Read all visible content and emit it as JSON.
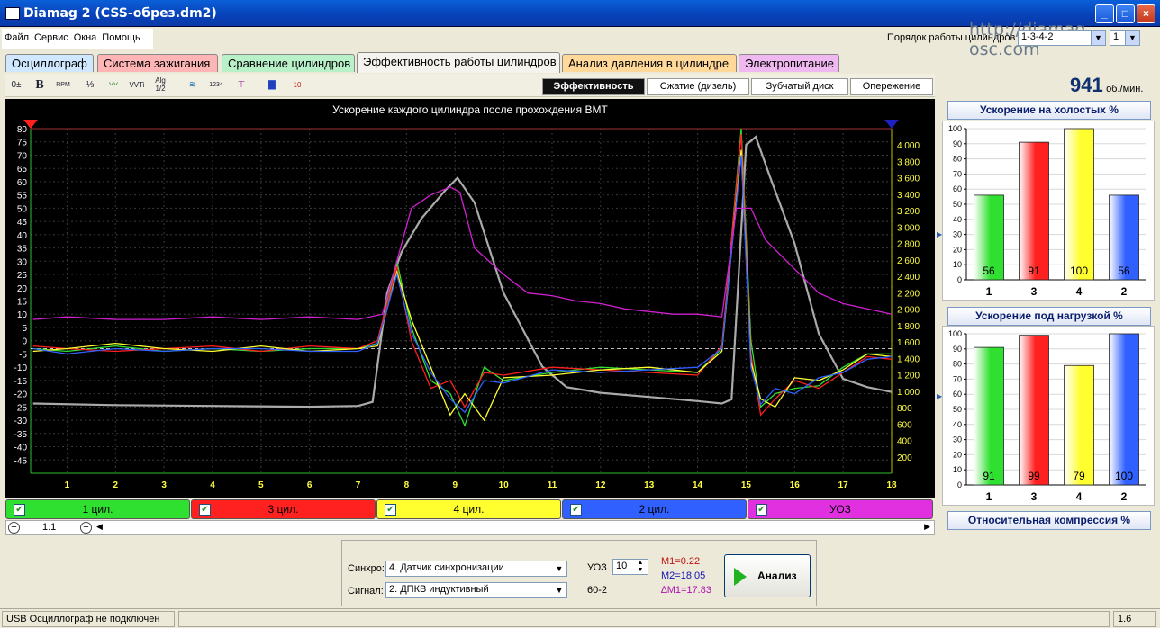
{
  "window": {
    "title": "Diamag 2 (CSS-обрез.dm2)",
    "minimize": "_",
    "maximize": "□",
    "close": "×"
  },
  "menu": [
    "Файл",
    "Сервис",
    "Окна",
    "Помощь"
  ],
  "watermark": "http://diamag-osc.com",
  "firing_order": {
    "label": "Порядок работы цилиндров",
    "value": "1-3-4-2",
    "second": "1"
  },
  "tabs": [
    {
      "label": "Осциллограф",
      "color": "#d0e8ff"
    },
    {
      "label": "Система зажигания",
      "color": "#ffb5b5"
    },
    {
      "label": "Сравнение цилиндров",
      "color": "#b8f0c8"
    },
    {
      "label": "Эффективность работы цилиндров",
      "color": "#f4f3ee"
    },
    {
      "label": "Анализ давления в цилиндре",
      "color": "#ffd89a"
    },
    {
      "label": "Электропитание",
      "color": "#f0b8f0"
    }
  ],
  "subtabs": [
    "Эффективность",
    "Сжатие (дизель)",
    "Зубчатый диск",
    "Опережение"
  ],
  "rpm": {
    "value": "941",
    "unit": "об./мин."
  },
  "toolbar_icons": [
    "scale-icon",
    "bold-icon",
    "rpm-icon",
    "ratio-icon",
    "zigzag-icon",
    "vvti-icon",
    "alg-icon",
    "sync-icon",
    "export-icon",
    "filter-icon",
    "bars-icon",
    "counter-icon"
  ],
  "toolbar_texts": {
    "bold": "B",
    "rpm": "RPM",
    "vvti": "VVTi",
    "alg": "Alg 1/2",
    "t34": "1234",
    "t10": "10"
  },
  "chart_data": {
    "type": "line",
    "title": "Ускорение каждого цилиндра после прохождения ВМТ",
    "x_ticks": [
      "1",
      "2",
      "3",
      "4",
      "5",
      "6",
      "7",
      "8",
      "9",
      "10",
      "11",
      "12",
      "13",
      "14",
      "15",
      "16",
      "17",
      "18"
    ],
    "y_left_ticks": [
      "80",
      "75",
      "70",
      "65",
      "60",
      "55",
      "50",
      "45",
      "40",
      "35",
      "30",
      "25",
      "20",
      "15",
      "10",
      "5",
      "0",
      "-5",
      "-10",
      "-15",
      "-20",
      "-25",
      "-30",
      "-35",
      "-40",
      "-45"
    ],
    "y_right_ticks": [
      "4 000",
      "3 800",
      "3 600",
      "3 400",
      "3 200",
      "3 000",
      "2 800",
      "2 600",
      "2 400",
      "2 200",
      "2 000",
      "1 800",
      "1 600",
      "1 400",
      "1 200",
      "1 000",
      "800",
      "600",
      "400",
      "200"
    ],
    "ylim_left": [
      -50,
      80
    ],
    "ylim_right": [
      0,
      4200
    ],
    "xlim": [
      0.25,
      18
    ],
    "series": [
      {
        "name": "1 цил.",
        "color": "#30e030",
        "x": [
          0.3,
          1,
          2,
          3,
          4,
          5,
          6,
          7,
          7.4,
          7.8,
          8.1,
          8.5,
          8.9,
          9.2,
          9.6,
          10,
          11,
          12,
          13,
          14,
          14.5,
          14.9,
          15.1,
          15.3,
          15.6,
          16,
          16.5,
          17,
          17.5,
          18
        ],
        "y": [
          -3,
          -4,
          -2,
          -4,
          -3,
          -4,
          -3,
          -3,
          -1,
          30,
          5,
          -15,
          -20,
          -32,
          -10,
          -15,
          -12,
          -10,
          -11,
          -12,
          -3,
          80,
          0,
          -25,
          -20,
          -18,
          -17,
          -10,
          -5,
          -5
        ]
      },
      {
        "name": "3 цил.",
        "color": "#ff2020",
        "x": [
          0.3,
          1,
          2,
          3,
          4,
          5,
          6,
          7,
          7.4,
          7.8,
          8.1,
          8.5,
          8.9,
          9.2,
          9.6,
          10,
          11,
          12,
          13,
          14,
          14.5,
          14.9,
          15.1,
          15.3,
          15.6,
          16,
          16.5,
          17,
          17.5,
          18
        ],
        "y": [
          -2,
          -3,
          -4,
          -3,
          -2,
          -4,
          -2,
          -3,
          0,
          28,
          0,
          -18,
          -15,
          -25,
          -12,
          -13,
          -10,
          -11,
          -12,
          -13,
          -2,
          78,
          -5,
          -28,
          -22,
          -15,
          -18,
          -12,
          -6,
          -7
        ]
      },
      {
        "name": "4 цил.",
        "color": "#ffff30",
        "x": [
          0.3,
          1,
          2,
          3,
          4,
          5,
          6,
          7,
          7.4,
          7.8,
          8.1,
          8.5,
          8.9,
          9.2,
          9.6,
          10,
          11,
          12,
          13,
          14,
          14.5,
          14.9,
          15.1,
          15.3,
          15.6,
          16,
          16.5,
          17,
          17.5,
          18
        ],
        "y": [
          -4,
          -3,
          -1,
          -3,
          -4,
          -2,
          -4,
          -3,
          -2,
          26,
          8,
          -10,
          -28,
          -20,
          -30,
          -14,
          -13,
          -11,
          -10,
          -12,
          -4,
          72,
          -8,
          -22,
          -25,
          -14,
          -15,
          -11,
          -5,
          -6
        ]
      },
      {
        "name": "2 цил.",
        "color": "#3060ff",
        "x": [
          0.3,
          1,
          2,
          3,
          4,
          5,
          6,
          7,
          7.4,
          7.8,
          8.1,
          8.5,
          8.9,
          9.2,
          9.6,
          10,
          11,
          12,
          13,
          14,
          14.5,
          14.9,
          15.1,
          15.3,
          15.6,
          16,
          16.5,
          17,
          17.5,
          18
        ],
        "y": [
          -3,
          -5,
          -3,
          -4,
          -3,
          -3,
          -4,
          -4,
          -1,
          25,
          3,
          -12,
          -22,
          -27,
          -15,
          -16,
          -11,
          -12,
          -11,
          -10,
          -3,
          70,
          -10,
          -24,
          -18,
          -20,
          -14,
          -12,
          -7,
          -6
        ]
      },
      {
        "name": "УОЗ",
        "color": "#d020d0",
        "x": [
          0.3,
          1,
          2,
          3,
          4,
          5,
          6,
          7,
          7.5,
          7.8,
          8.1,
          8.5,
          8.9,
          9.1,
          9.4,
          10,
          10.5,
          11,
          11.5,
          12,
          12.5,
          13,
          13.5,
          14,
          14.5,
          14.8,
          15.1,
          15.4,
          16,
          16.5,
          17,
          17.5,
          18
        ],
        "y": [
          8,
          9,
          8,
          8,
          9,
          8,
          9,
          8,
          10,
          30,
          50,
          55,
          58,
          56,
          35,
          25,
          18,
          17,
          15,
          14,
          12,
          11,
          10,
          10,
          9,
          50,
          50,
          38,
          27,
          18,
          14,
          12,
          10
        ]
      },
      {
        "name": "Обороты",
        "color": "#aaaaaa",
        "axis": "right",
        "x": [
          0.3,
          2,
          4,
          6,
          7,
          7.3,
          7.6,
          7.9,
          8.3,
          8.8,
          9.05,
          9.4,
          10,
          10.8,
          11.3,
          12,
          13,
          14,
          14.5,
          14.7,
          15.0,
          15.2,
          15.5,
          16,
          16.5,
          17,
          17.5,
          18
        ],
        "y": [
          850,
          830,
          820,
          810,
          820,
          870,
          2200,
          2700,
          3100,
          3450,
          3600,
          3300,
          2200,
          1300,
          1050,
          980,
          930,
          880,
          850,
          900,
          4000,
          4100,
          3600,
          2800,
          1700,
          1150,
          1050,
          990
        ]
      }
    ],
    "markers": {
      "left_triangle": "#ff2020",
      "right_triangle": "#2020c0"
    },
    "dashed_reference_y": -3
  },
  "legend": [
    {
      "label": "1 цил.",
      "bg": "#30e030",
      "check": "✔"
    },
    {
      "label": "3 цил.",
      "bg": "#ff2020",
      "check": "✔"
    },
    {
      "label": "4 цил.",
      "bg": "#ffff30",
      "check": "✔"
    },
    {
      "label": "2 цил.",
      "bg": "#3060ff",
      "check": "✔"
    },
    {
      "label": "УОЗ",
      "bg": "#e030e0",
      "check": "✔"
    }
  ],
  "scroll": {
    "minus": "−",
    "zoom": "1:1",
    "plus": "+",
    "left": "◀",
    "right": "▶"
  },
  "idle_panel": {
    "title": "Ускорение на холостых %",
    "chart_data": {
      "type": "bar",
      "categories": [
        "1",
        "3",
        "4",
        "2"
      ],
      "values": [
        56,
        91,
        100,
        56
      ],
      "colors": [
        "#30e030",
        "#ff2020",
        "#ffff30",
        "#3060ff"
      ],
      "ylim": [
        0,
        100
      ],
      "y_ticks": [
        "100",
        "90",
        "80",
        "70",
        "60",
        "50",
        "40",
        "30",
        "20",
        "10",
        "0"
      ]
    }
  },
  "load_panel": {
    "title": "Ускорение под нагрузкой %",
    "chart_data": {
      "type": "bar",
      "categories": [
        "1",
        "3",
        "4",
        "2"
      ],
      "values": [
        91,
        99,
        79,
        100
      ],
      "colors": [
        "#30e030",
        "#ff2020",
        "#ffff30",
        "#3060ff"
      ],
      "ylim": [
        0,
        100
      ],
      "y_ticks": [
        "100",
        "90",
        "80",
        "70",
        "60",
        "50",
        "40",
        "30",
        "20",
        "10",
        "0"
      ]
    }
  },
  "compression_button": "Относительная компрессия %",
  "bottom": {
    "sync_label": "Синхро:",
    "sync_value": "4.  Датчик синхронизации",
    "signal_label": "Сигнал:",
    "signal_value": "2.  ДПКВ индуктивный",
    "uoz_label": "УОЗ",
    "uoz_value": "10",
    "teeth": "60-2",
    "m1": "M1=0.22",
    "m2": "M2=18.05",
    "dm1": "∆M1=17.83",
    "analyze": "Анализ"
  },
  "status": {
    "left": "USB Осциллограф не подключен",
    "right": "1.6"
  }
}
